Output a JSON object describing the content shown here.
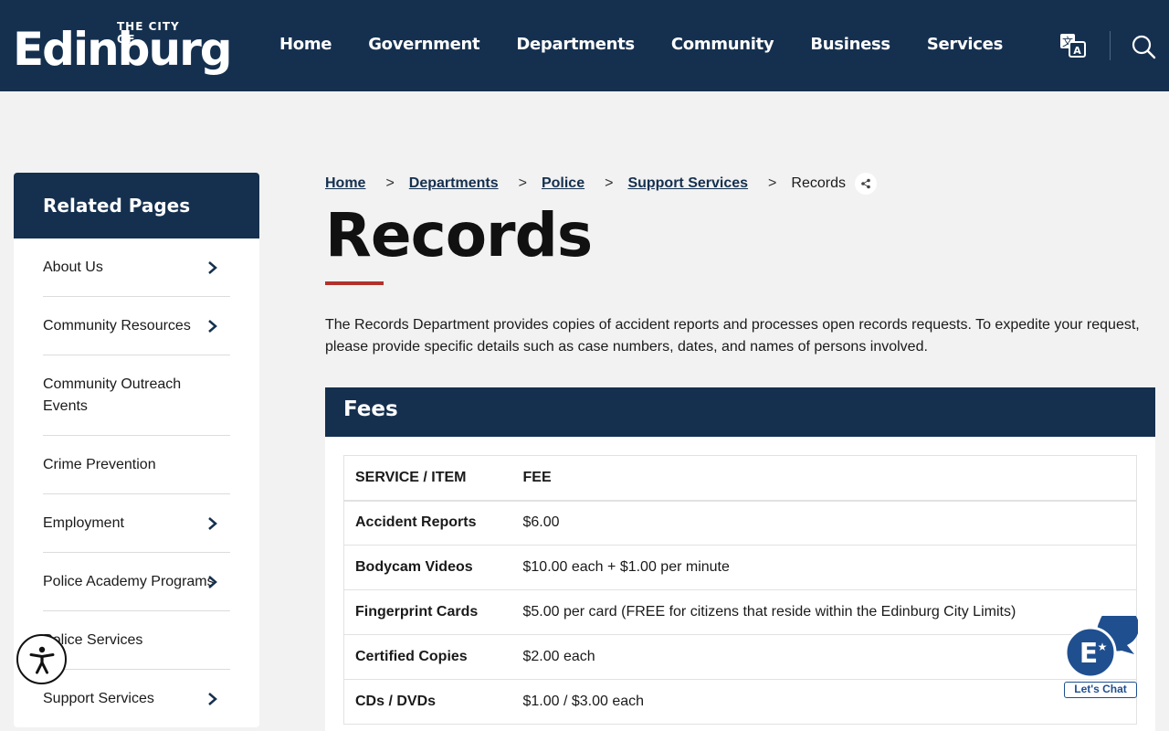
{
  "header": {
    "logo_small": "THE CITY OF",
    "logo_big": "Edinburg",
    "nav": [
      "Home",
      "Government",
      "Departments",
      "Community",
      "Business",
      "Services"
    ]
  },
  "sidebar": {
    "title": "Related Pages",
    "items": [
      {
        "label": "About Us",
        "chevron": true
      },
      {
        "label": "Community Resources",
        "chevron": true
      },
      {
        "label": "Community Outreach Events",
        "chevron": false
      },
      {
        "label": "Crime Prevention",
        "chevron": false
      },
      {
        "label": "Employment",
        "chevron": true
      },
      {
        "label": "Police Academy Programs",
        "chevron": true
      },
      {
        "label": "Police Services",
        "chevron": false
      },
      {
        "label": "Support Services",
        "chevron": true
      }
    ]
  },
  "breadcrumb": {
    "links": [
      "Home",
      "Departments",
      "Police",
      "Support Services"
    ],
    "separator": ">",
    "current": "Records"
  },
  "page": {
    "title": "Records",
    "intro": "The Records Department provides copies of accident reports and processes open records requests. To expedite your request, please provide specific details such as case numbers, dates, and names of persons involved."
  },
  "fees": {
    "title": "Fees",
    "headers": [
      "SERVICE / ITEM",
      "FEE"
    ],
    "rows": [
      [
        "Accident Reports",
        "$6.00"
      ],
      [
        "Bodycam Videos",
        "$10.00 each + $1.00 per minute"
      ],
      [
        "Fingerprint Cards",
        "$5.00 per card (FREE for citizens that reside within the Edinburg City Limits)"
      ],
      [
        "Certified Copies",
        "$2.00 each"
      ],
      [
        "CDs / DVDs",
        "$1.00 / $3.00 each"
      ]
    ]
  },
  "chat": {
    "label": "Let's Chat"
  },
  "colors": {
    "navy": "#15304f",
    "accent_red": "#b3312c",
    "chat_blue": "#1f4f8f"
  },
  "icons": {
    "translate": "translate-icon",
    "search": "search-icon",
    "share": "share-icon",
    "accessibility": "accessibility-icon",
    "chat": "chat-icon"
  }
}
